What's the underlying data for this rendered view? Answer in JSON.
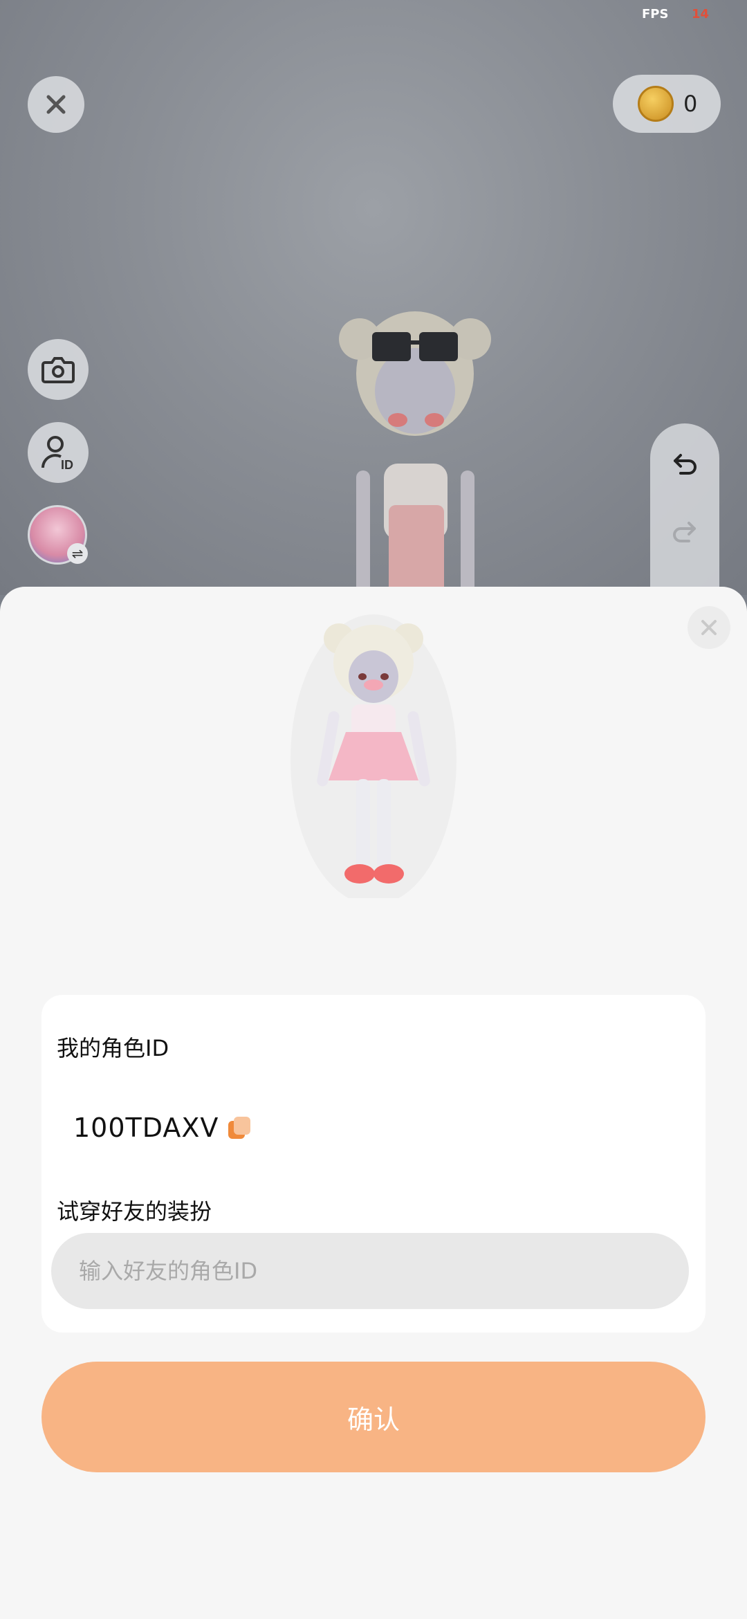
{
  "status": {
    "fps_label": "FPS",
    "fps_value": "14"
  },
  "top_bar": {
    "close_icon": "close-icon",
    "coin_icon": "coin-icon",
    "coin_count": "0"
  },
  "side_tools": {
    "camera_icon": "camera-icon",
    "id_icon": "user-id-icon",
    "avatar_switch_icon": "swap-icon"
  },
  "history": {
    "undo_icon": "undo-icon",
    "redo_icon": "redo-icon"
  },
  "sheet": {
    "my_id_label": "我的角色ID",
    "my_id_value": "100TDAXV",
    "try_on_label": "试穿好友的装扮",
    "friend_id_placeholder": "输入好友的角色ID",
    "confirm_label": "确认"
  },
  "colors": {
    "accent": "#f8b484",
    "copy_icon": "#f08a3a",
    "fps_value": "#e0503a"
  }
}
